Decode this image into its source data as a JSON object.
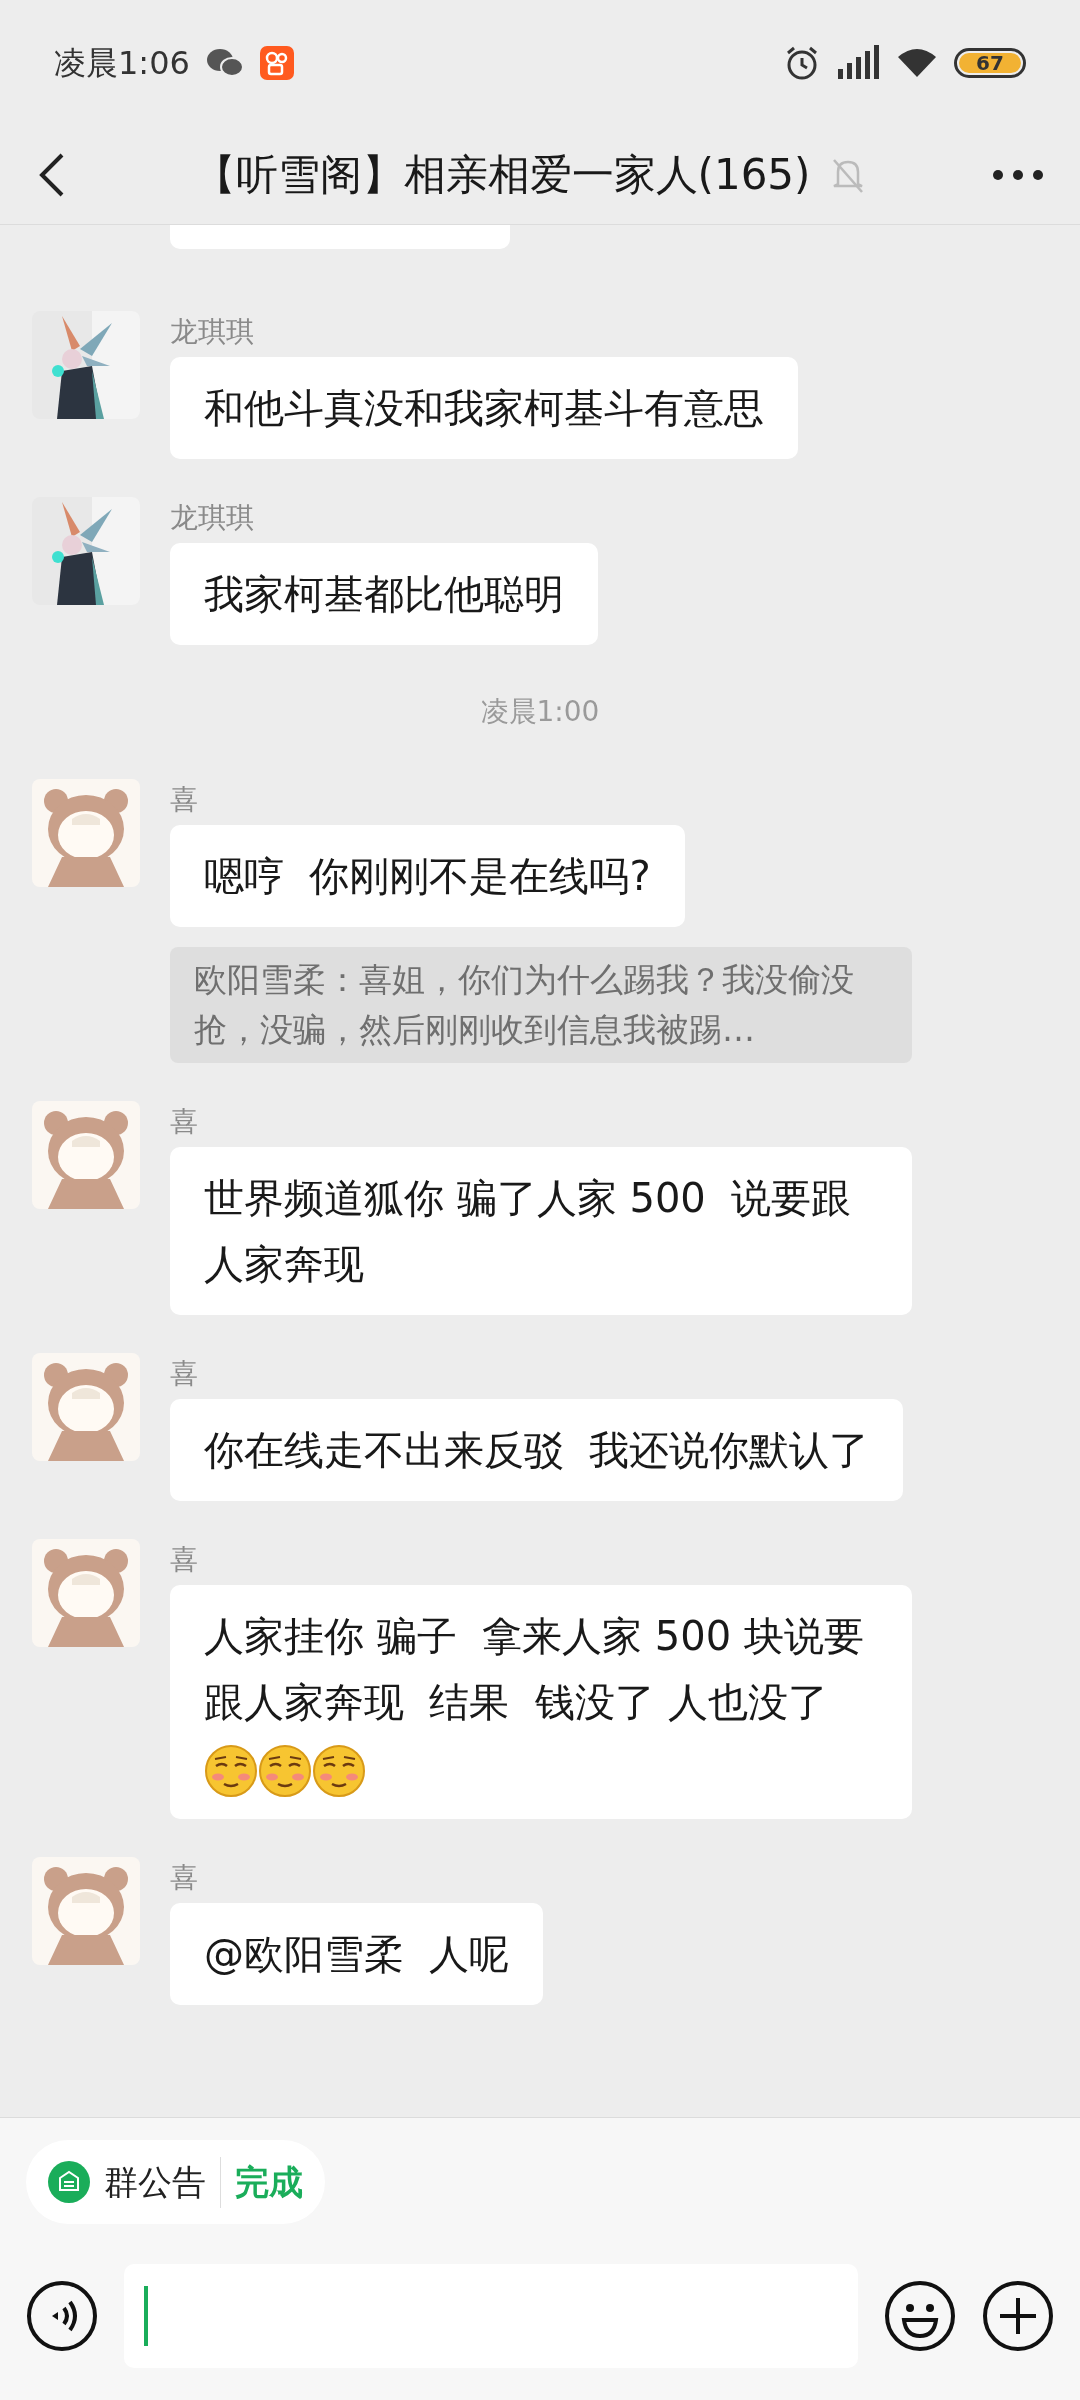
{
  "status_bar": {
    "time": "凌晨1:06",
    "battery": "67"
  },
  "header": {
    "title": "【听雪阁】相亲相爱一家人(165)",
    "muted": true
  },
  "messages": [
    {
      "kind": "cut-bubble"
    },
    {
      "kind": "text",
      "avatar": {
        "kind": "creature"
      },
      "sender": "龙琪琪",
      "text": "和他斗真没和我家柯基斗有意思"
    },
    {
      "kind": "text",
      "avatar": {
        "kind": "creature"
      },
      "sender": "龙琪琪",
      "text": "我家柯基都比他聪明"
    },
    {
      "kind": "time",
      "text": "凌晨1:00"
    },
    {
      "kind": "text",
      "avatar": {
        "kind": "bear"
      },
      "sender": "喜",
      "text": "嗯哼  你刚刚不是在线吗?"
    },
    {
      "kind": "quote",
      "text": "欧阳雪柔：喜姐，你们为什么踢我？我没偷没抢，没骗，然后刚刚收到信息我被踢…"
    },
    {
      "kind": "text",
      "avatar": {
        "kind": "bear"
      },
      "sender": "喜",
      "text": "世界频道狐你 骗了人家 500  说要跟人家奔现"
    },
    {
      "kind": "text",
      "avatar": {
        "kind": "bear"
      },
      "sender": "喜",
      "text": "你在线走不出来反驳  我还说你默认了"
    },
    {
      "kind": "text",
      "avatar": {
        "kind": "bear"
      },
      "sender": "喜",
      "text": "人家挂你 骗子  拿来人家 500 块说要跟人家奔现  结果  钱没了 人也没了",
      "emojis": [
        {
          "kind": "blush"
        },
        {
          "kind": "blush"
        },
        {
          "kind": "blush"
        }
      ]
    },
    {
      "kind": "text",
      "avatar": {
        "kind": "bear"
      },
      "sender": "喜",
      "text": "@欧阳雪柔  人呢"
    }
  ],
  "announcement": {
    "label": "群公告",
    "action": "完成"
  }
}
